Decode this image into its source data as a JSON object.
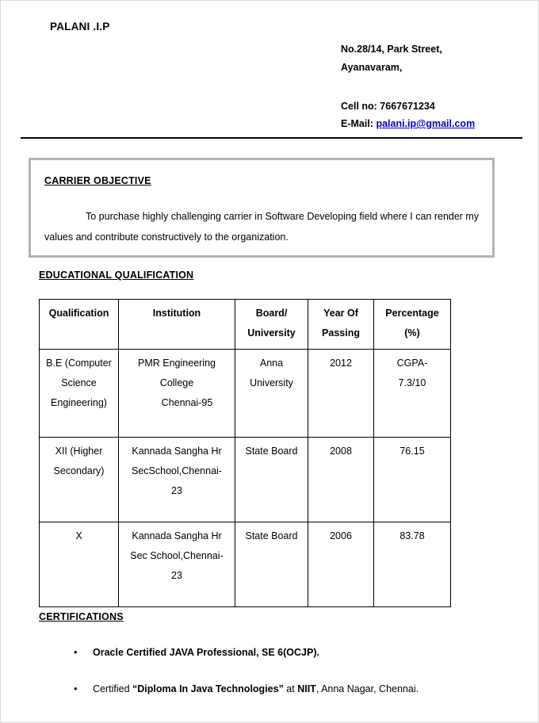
{
  "header": {
    "name": "PALANI .I.P",
    "address_lines": [
      "No.28/14, Park Street,",
      "Ayanavaram,"
    ],
    "cell": "Cell no: 7667671234",
    "email_label": "E-Mail:",
    "email": "palani.ip@gmail.com"
  },
  "objective": {
    "heading": "CARRIER OBJECTIVE",
    "text": "To purchase highly challenging carrier in Software Developing field where I can render my values and  contribute constructively to the organization."
  },
  "education": {
    "heading": "EDUCATIONAL QUALIFICATION",
    "columns": [
      "Qualification",
      "Institution",
      "Board/ University",
      "Year Of Passing",
      "Percentage (%)"
    ],
    "column_lines": [
      [
        "Qualification"
      ],
      [
        "Institution"
      ],
      [
        "Board/",
        "University"
      ],
      [
        "Year Of",
        "Passing"
      ],
      [
        "Percentage",
        "(%)"
      ]
    ],
    "rows": [
      {
        "qualification": "B.E (Computer Science Engineering)",
        "institution_lines": [
          "PMR Engineering",
          "College",
          "Chennai-95"
        ],
        "board": "Anna University",
        "year": "2012",
        "percentage_lines": [
          "CGPA-",
          "7.3/10"
        ]
      },
      {
        "qualification": "XII (Higher Secondary)",
        "institution_lines": [
          "Kannada Sangha Hr",
          "SecSchool,Chennai-",
          "23"
        ],
        "board": "State Board",
        "year": "2008",
        "percentage": "76.15"
      },
      {
        "qualification": "X",
        "institution_lines": [
          "Kannada Sangha Hr",
          "Sec School,Chennai-",
          "23"
        ],
        "board": "State Board",
        "year": "2006",
        "percentage": "83.78"
      }
    ]
  },
  "certifications": {
    "heading": "CERTIFICATIONS",
    "bullet_glyph": "•",
    "items": [
      {
        "segments": [
          {
            "text": "Oracle Certified JAVA Professional, SE 6(OCJP).",
            "bold": true
          }
        ]
      },
      {
        "segments": [
          {
            "text": "Certified ",
            "bold": false
          },
          {
            "text": "“Diploma In Java Technologies”",
            "bold": true
          },
          {
            "text": " at ",
            "bold": false
          },
          {
            "text": "NIIT",
            "bold": true
          },
          {
            "text": ", Anna Nagar,  Chennai.",
            "bold": false
          }
        ]
      }
    ]
  },
  "colors": {
    "link": "#0000cc",
    "box_border": "#b3b3b3",
    "rule": "#000000",
    "text": "#000000"
  }
}
